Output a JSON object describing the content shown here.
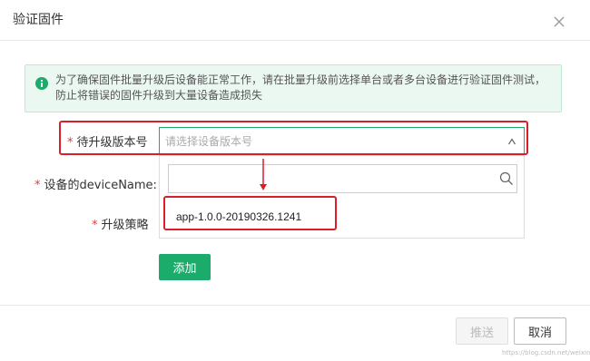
{
  "dialog": {
    "title": "验证固件",
    "close_icon": "close-icon"
  },
  "alert": {
    "icon": "info-icon",
    "text": "为了确保固件批量升级后设备能正常工作，请在批量升级前选择单台或者多台设备进行验证固件测试，防止将错误的固件升级到大量设备造成损失"
  },
  "form": {
    "required_mark": "*",
    "version_label": "待升级版本号",
    "version_placeholder": "请选择设备版本号",
    "device_label": "设备的deviceName:",
    "strategy_label": "升级策略",
    "add_label": "添加"
  },
  "dropdown": {
    "search_value": "",
    "options": [
      "app-1.0.0-20190326.1241"
    ]
  },
  "footer": {
    "push_label": "推送",
    "cancel_label": "取消"
  },
  "watermark": "https://blog.csdn.net/weixin_..."
}
